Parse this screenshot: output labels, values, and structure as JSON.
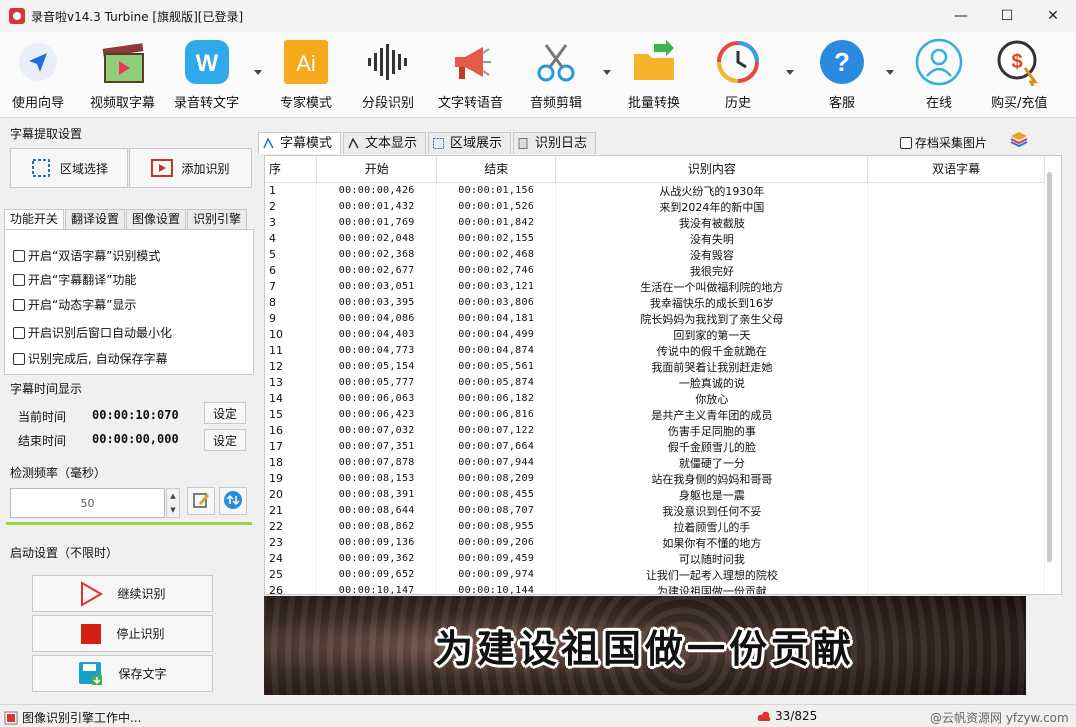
{
  "window": {
    "title": "录音啦v14.3 Turbine [旗舰版][已登录]",
    "controls": {
      "minimize": "—",
      "maximize": "☐",
      "close": "✕"
    }
  },
  "toolbar": {
    "items": [
      {
        "label": "使用向导",
        "icon": "navigate-arrow-icon"
      },
      {
        "label": "视频取字幕",
        "icon": "film-clapper-icon"
      },
      {
        "label": "录音转文字",
        "icon": "w-badge-icon",
        "dropdown": true
      },
      {
        "label": "专家模式",
        "icon": "ai-badge-icon"
      },
      {
        "label": "分段识别",
        "icon": "waveform-icon"
      },
      {
        "label": "文字转语音",
        "icon": "megaphone-icon"
      },
      {
        "label": "音频剪辑",
        "icon": "scissors-icon",
        "dropdown": true
      },
      {
        "label": "批量转换",
        "icon": "folder-arrow-icon"
      },
      {
        "label": "历史",
        "icon": "history-clock-icon",
        "dropdown": true
      },
      {
        "label": "客服",
        "icon": "help-question-icon",
        "dropdown": true
      },
      {
        "label": "在线",
        "icon": "user-online-icon"
      },
      {
        "label": "购买/充值",
        "icon": "purchase-coin-icon"
      }
    ],
    "icon_letters": {
      "w": "W",
      "ai": "Ai",
      "help": "?",
      "coin": "$"
    }
  },
  "left": {
    "extract_title": "字幕提取设置",
    "region_select": "区域选择",
    "add_recognize": "添加识别",
    "tabs": [
      "功能开关",
      "翻译设置",
      "图像设置",
      "识别引擎"
    ],
    "options": [
      "开启“双语字幕”识别模式",
      "开启“字幕翻译”功能",
      "开启“动态字幕”显示",
      "开启识别后窗口自动最小化",
      "识别完成后, 自动保存字幕"
    ],
    "time_title": "字幕时间显示",
    "current_time_label": "当前时间",
    "current_time": "00:00:10:070",
    "end_time_label": "结束时间",
    "end_time": "00:00:00,000",
    "set_label": "设定",
    "freq_title": "检测频率（毫秒）",
    "freq_value": "50",
    "spin_up": "▲",
    "spin_down": "▼",
    "start_title": "启动设置（不限时）",
    "continue": "继续识别",
    "stop": "停止识别",
    "save": "保存文字"
  },
  "right": {
    "tabs": [
      "字幕模式",
      "文本显示",
      "区域展示",
      "识别日志"
    ],
    "save_images": "存档采集图片",
    "columns": [
      "序",
      "开始",
      "结束",
      "识别内容",
      "双语字幕"
    ],
    "rows": [
      [
        "1",
        "00:00:00,426",
        "00:00:01,156",
        "从战火纷飞的1930年"
      ],
      [
        "2",
        "00:00:01,432",
        "00:00:01,526",
        "来到2024年的新中国"
      ],
      [
        "3",
        "00:00:01,769",
        "00:00:01,842",
        "我没有被截肢"
      ],
      [
        "4",
        "00:00:02,048",
        "00:00:02,155",
        "没有失明"
      ],
      [
        "5",
        "00:00:02,368",
        "00:00:02,468",
        "没有毁容"
      ],
      [
        "6",
        "00:00:02,677",
        "00:00:02,746",
        "我很完好"
      ],
      [
        "7",
        "00:00:03,051",
        "00:00:03,121",
        "生活在一个叫做福利院的地方"
      ],
      [
        "8",
        "00:00:03,395",
        "00:00:03,806",
        "我幸福快乐的成长到16岁"
      ],
      [
        "9",
        "00:00:04,086",
        "00:00:04,181",
        "院长妈妈为我找到了亲生父母"
      ],
      [
        "10",
        "00:00:04,403",
        "00:00:04,499",
        "回到家的第一天"
      ],
      [
        "11",
        "00:00:04,773",
        "00:00:04,874",
        "传说中的假千金就跪在"
      ],
      [
        "12",
        "00:00:05,154",
        "00:00:05,561",
        "我面前哭着让我别赶走她"
      ],
      [
        "13",
        "00:00:05,777",
        "00:00:05,874",
        "一脸真诚的说"
      ],
      [
        "14",
        "00:00:06,063",
        "00:00:06,182",
        "你放心"
      ],
      [
        "15",
        "00:00:06,423",
        "00:00:06,816",
        "是共产主义青年团的成员"
      ],
      [
        "16",
        "00:00:07,032",
        "00:00:07,122",
        "伤害手足同胞的事"
      ],
      [
        "17",
        "00:00:07,351",
        "00:00:07,664",
        "假千金顾雪儿的脸"
      ],
      [
        "18",
        "00:00:07,878",
        "00:00:07,944",
        "就僵硬了一分"
      ],
      [
        "19",
        "00:00:08,153",
        "00:00:08,209",
        "站在我身侧的妈妈和哥哥"
      ],
      [
        "20",
        "00:00:08,391",
        "00:00:08,455",
        "身躯也是一震"
      ],
      [
        "21",
        "00:00:08,644",
        "00:00:08,707",
        "我没意识到任何不妥"
      ],
      [
        "22",
        "00:00:08,862",
        "00:00:08,955",
        "拉着顾雪儿的手"
      ],
      [
        "23",
        "00:00:09,136",
        "00:00:09,206",
        "如果你有不懂的地方"
      ],
      [
        "24",
        "00:00:09,362",
        "00:00:09,459",
        "可以随时问我"
      ],
      [
        "25",
        "00:00:09,652",
        "00:00:09,974",
        "让我们一起考入理想的院校"
      ],
      [
        "26",
        "00:00:10,147",
        "00:00:10,144",
        "为建设祖国做一份贡献"
      ]
    ],
    "preview_subtitle": "为建设祖国做一份贡献"
  },
  "status": {
    "left": "图像识别引擎工作中...",
    "progress": "33/825",
    "watermark": "@云帆资源网 yfzyw.com"
  }
}
